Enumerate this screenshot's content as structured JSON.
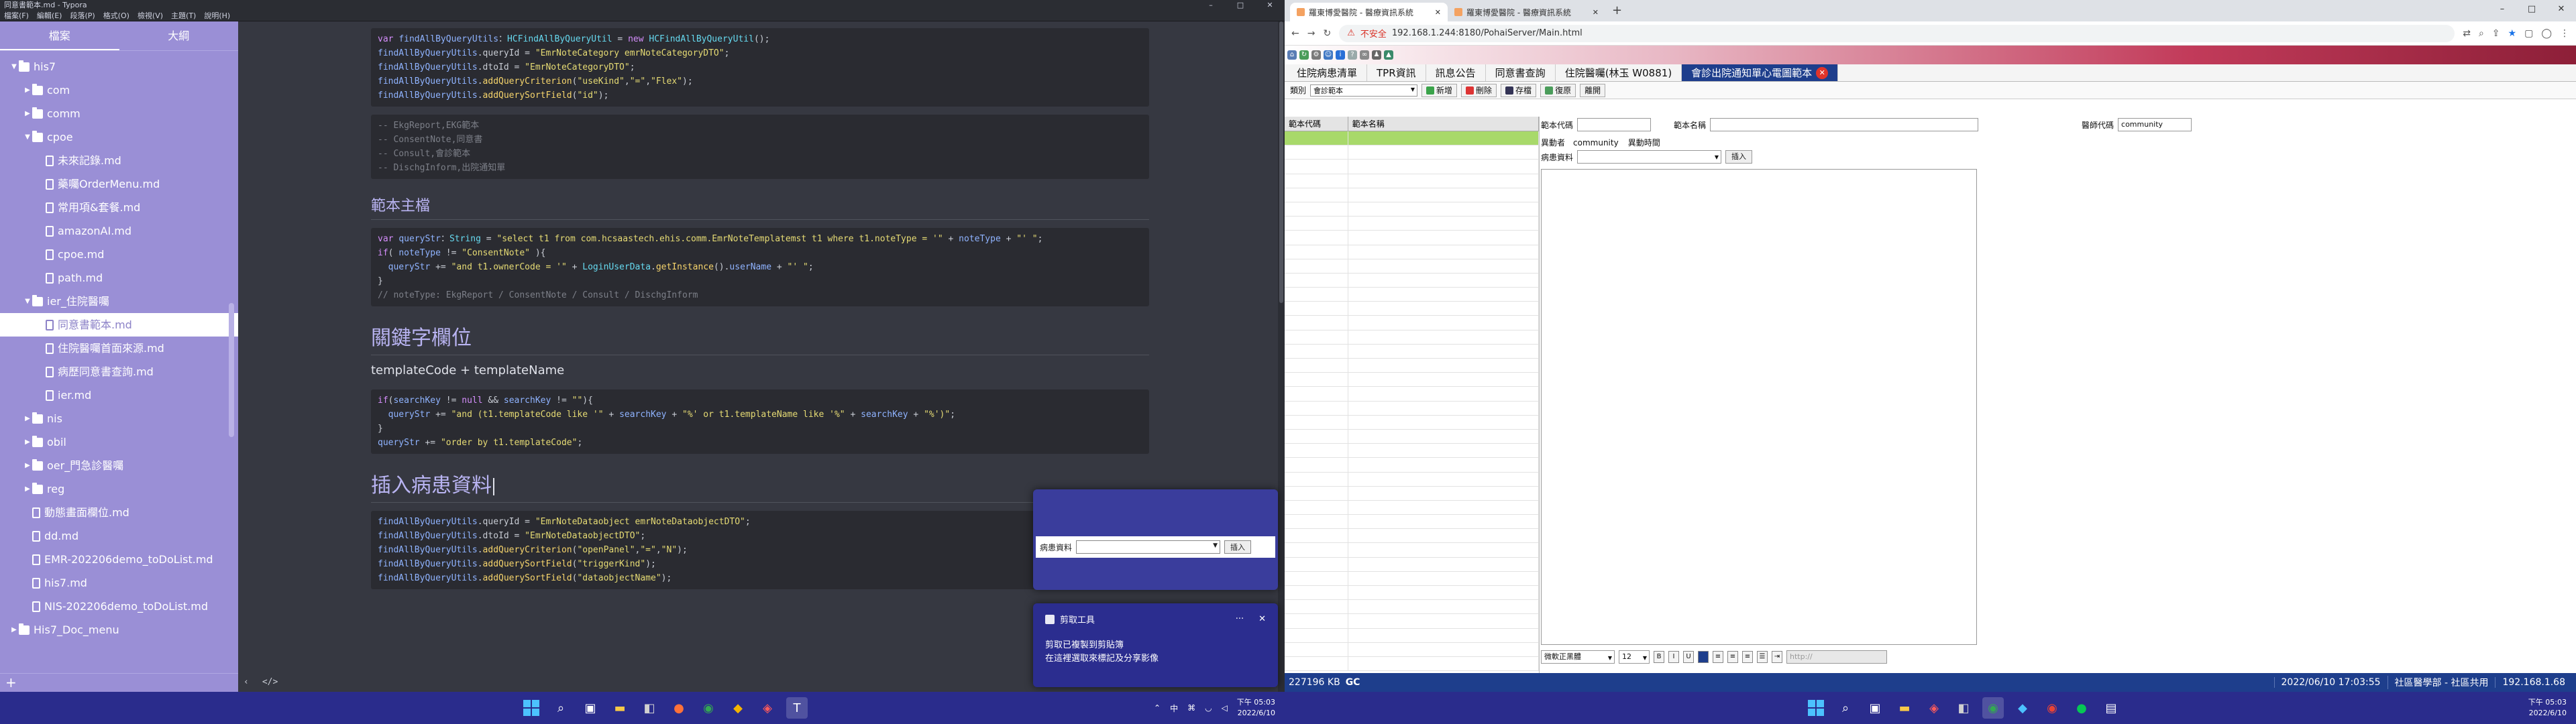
{
  "typora": {
    "title": "同意書範本.md - Typora",
    "menu": [
      "檔案(F)",
      "編輯(E)",
      "段落(P)",
      "格式(O)",
      "檢視(V)",
      "主題(T)",
      "說明(H)"
    ],
    "sidebar_tabs": [
      "檔案",
      "大綱"
    ],
    "tree": [
      {
        "label": "his7",
        "type": "folder",
        "depth": 0,
        "open": true
      },
      {
        "label": "com",
        "type": "folder",
        "depth": 1,
        "open": false
      },
      {
        "label": "comm",
        "type": "folder",
        "depth": 1,
        "open": false
      },
      {
        "label": "cpoe",
        "type": "folder",
        "depth": 1,
        "open": true
      },
      {
        "label": "未來記錄.md",
        "type": "file",
        "depth": 2
      },
      {
        "label": "藥囑OrderMenu.md",
        "type": "file",
        "depth": 2
      },
      {
        "label": "常用項&套餐.md",
        "type": "file",
        "depth": 2
      },
      {
        "label": "amazonAI.md",
        "type": "file",
        "depth": 2
      },
      {
        "label": "cpoe.md",
        "type": "file",
        "depth": 2
      },
      {
        "label": "path.md",
        "type": "file",
        "depth": 2
      },
      {
        "label": "ier_住院醫囑",
        "type": "folder",
        "depth": 1,
        "open": true
      },
      {
        "label": "同意書範本.md",
        "type": "file",
        "depth": 2,
        "selected": true
      },
      {
        "label": "住院醫囑首面來源.md",
        "type": "file",
        "depth": 2
      },
      {
        "label": "病歷同意書查詢.md",
        "type": "file",
        "depth": 2
      },
      {
        "label": "ier.md",
        "type": "file",
        "depth": 2
      },
      {
        "label": "nis",
        "type": "folder",
        "depth": 1,
        "open": false
      },
      {
        "label": "obil",
        "type": "folder",
        "depth": 1,
        "open": false
      },
      {
        "label": "oer_門急診醫囑",
        "type": "folder",
        "depth": 1,
        "open": false
      },
      {
        "label": "reg",
        "type": "folder",
        "depth": 1,
        "open": false
      },
      {
        "label": "動態畫面欄位.md",
        "type": "file",
        "depth": 1
      },
      {
        "label": "dd.md",
        "type": "file",
        "depth": 1
      },
      {
        "label": "EMR-202206demo_toDoList.md",
        "type": "file",
        "depth": 1
      },
      {
        "label": "his7.md",
        "type": "file",
        "depth": 1
      },
      {
        "label": "NIS-202206demo_toDoList.md",
        "type": "file",
        "depth": 1
      },
      {
        "label": "His7_Doc_menu",
        "type": "folder",
        "depth": 0,
        "open": false
      }
    ],
    "sidebar_add": "+",
    "code1": [
      [
        [
          "kw",
          "var "
        ],
        [
          "vr",
          "findAllByQueryUtils"
        ],
        [
          "",
          "："
        ],
        [
          "ty",
          "HCFindAllByQueryUtil"
        ],
        [
          "",
          " = "
        ],
        [
          "kw",
          "new "
        ],
        [
          "ty",
          "HCFindAllByQueryUtil"
        ],
        [
          "",
          "();"
        ]
      ],
      [
        [
          "vr",
          "findAllByQueryUtils"
        ],
        [
          "",
          ".queryId = "
        ],
        [
          "st",
          "\"EmrNoteCategory emrNoteCategoryDTO\""
        ],
        [
          "",
          ";"
        ]
      ],
      [
        [
          "vr",
          "findAllByQueryUtils"
        ],
        [
          "",
          ".dtoId = "
        ],
        [
          "st",
          "\"EmrNoteCategoryDTO\""
        ],
        [
          "",
          ";"
        ]
      ],
      [
        [
          "vr",
          "findAllByQueryUtils"
        ],
        [
          "",
          "."
        ],
        [
          "fn",
          "addQueryCriterion"
        ],
        [
          "",
          "("
        ],
        [
          "st",
          "\"useKind\""
        ],
        [
          "",
          ","
        ],
        [
          "st",
          "\"=\""
        ],
        [
          "",
          ","
        ],
        [
          "st",
          "\"Flex\""
        ],
        [
          "",
          ");"
        ]
      ],
      [
        [
          "vr",
          "findAllByQueryUtils"
        ],
        [
          "",
          "."
        ],
        [
          "fn",
          "addQuerySortField"
        ],
        [
          "",
          "("
        ],
        [
          "st",
          "\"id\""
        ],
        [
          "",
          ");"
        ]
      ]
    ],
    "code2": [
      [
        [
          "cm",
          "-- EkgReport,EKG範本"
        ]
      ],
      [
        [
          "cm",
          "-- ConsentNote,同意書"
        ]
      ],
      [
        [
          "cm",
          "-- Consult,會診範本"
        ]
      ],
      [
        [
          "cm",
          "-- DischgInform,出院通知單"
        ]
      ]
    ],
    "h_template": "範本主檔",
    "code3": [
      [
        [
          "kw",
          "var "
        ],
        [
          "vr",
          "queryStr"
        ],
        [
          "",
          "："
        ],
        [
          "ty",
          "String"
        ],
        [
          "",
          " = "
        ],
        [
          "st",
          "\"select t1 from com.hcsaastech.ehis.comm.EmrNoteTemplatemst t1 where t1.noteType = '\""
        ],
        [
          "",
          " + "
        ],
        [
          "vr",
          "noteType"
        ],
        [
          "",
          " + "
        ],
        [
          "st",
          "\"' \""
        ],
        [
          "",
          ";"
        ]
      ],
      [
        [
          "kw",
          "if"
        ],
        [
          "",
          "( "
        ],
        [
          "vr",
          "noteType"
        ],
        [
          "",
          " != "
        ],
        [
          "st",
          "\"ConsentNote\""
        ],
        [
          "",
          " ){"
        ]
      ],
      [
        [
          "",
          "  "
        ],
        [
          "vr",
          "queryStr"
        ],
        [
          "",
          " += "
        ],
        [
          "st",
          "\"and t1.ownerCode = '\""
        ],
        [
          "",
          " + "
        ],
        [
          "ty",
          "LoginUserData"
        ],
        [
          "",
          "."
        ],
        [
          "fn",
          "getInstance"
        ],
        [
          "",
          "()."
        ],
        [
          "vr",
          "userName"
        ],
        [
          "",
          " + "
        ],
        [
          "st",
          "\"' \""
        ],
        [
          "",
          ";"
        ]
      ],
      [
        [
          "",
          "}"
        ]
      ],
      [
        [
          "cm",
          "// noteType: EkgReport / ConsentNote / Consult / DischgInform"
        ]
      ]
    ],
    "h_keyword": "關鍵字欄位",
    "para_keyword": "templateCode + templateName",
    "code4": [
      [
        [
          "kw",
          "if"
        ],
        [
          "",
          "("
        ],
        [
          "vr",
          "searchKey"
        ],
        [
          "",
          " != "
        ],
        [
          "kw",
          "null"
        ],
        [
          "",
          " && "
        ],
        [
          "vr",
          "searchKey"
        ],
        [
          "",
          " != "
        ],
        [
          "st",
          "\"\""
        ],
        [
          "",
          "){"
        ]
      ],
      [
        [
          "",
          "  "
        ],
        [
          "vr",
          "queryStr"
        ],
        [
          "",
          " += "
        ],
        [
          "st",
          "\"and (t1.templateCode like '\""
        ],
        [
          "",
          " + "
        ],
        [
          "vr",
          "searchKey"
        ],
        [
          "",
          " + "
        ],
        [
          "st",
          "\"%' or t1.templateName like '%\""
        ],
        [
          "",
          " + "
        ],
        [
          "vr",
          "searchKey"
        ],
        [
          "",
          " + "
        ],
        [
          "st",
          "\"%')\""
        ],
        [
          "",
          ";"
        ]
      ],
      [
        [
          "",
          "}"
        ]
      ],
      [
        [
          "vr",
          "queryStr"
        ],
        [
          "",
          " += "
        ],
        [
          "st",
          "\"order by t1.templateCode\""
        ],
        [
          "",
          ";"
        ]
      ]
    ],
    "h_insert": "插入病患資料",
    "code5": [
      [
        [
          "vr",
          "findAllByQueryUtils"
        ],
        [
          "",
          ".queryId = "
        ],
        [
          "st",
          "\"EmrNoteDataobject emrNoteDataobjectDTO\""
        ],
        [
          "",
          ";"
        ]
      ],
      [
        [
          "vr",
          "findAllByQueryUtils"
        ],
        [
          "",
          ".dtoId = "
        ],
        [
          "st",
          "\"EmrNoteDataobjectDTO\""
        ],
        [
          "",
          ";"
        ]
      ],
      [
        [
          "vr",
          "findAllByQueryUtils"
        ],
        [
          "",
          "."
        ],
        [
          "fn",
          "addQueryCriterion"
        ],
        [
          "",
          "("
        ],
        [
          "st",
          "\"openPanel\""
        ],
        [
          "",
          ","
        ],
        [
          "st",
          "\"=\""
        ],
        [
          "",
          ","
        ],
        [
          "st",
          "\"N\""
        ],
        [
          "",
          ");"
        ]
      ],
      [
        [
          "vr",
          "findAllByQueryUtils"
        ],
        [
          "",
          "."
        ],
        [
          "fn",
          "addQuerySortField"
        ],
        [
          "",
          "("
        ],
        [
          "st",
          "\"triggerKind\""
        ],
        [
          "",
          ");"
        ]
      ],
      [
        [
          "vr",
          "findAllByQueryUtils"
        ],
        [
          "",
          "."
        ],
        [
          "fn",
          "addQuerySortField"
        ],
        [
          "",
          "("
        ],
        [
          "st",
          "\"dataobjectName\""
        ],
        [
          "",
          ");"
        ]
      ]
    ],
    "status_nav": "‹",
    "status_source": "</>"
  },
  "popup": {
    "label": "病患資料",
    "insert": "插入"
  },
  "notification": {
    "app": "剪取工具",
    "menu": "···",
    "close": "✕",
    "line1": "剪取已複製到剪貼簿",
    "line2": "在這裡選取來標記及分享影像"
  },
  "taskbar_left": {
    "tray_ime": "中",
    "time": "下午 05:03",
    "date": "2022/6/10"
  },
  "taskbar_right": {
    "time": "下午 05:03",
    "date": "2022/6/10"
  },
  "browser": {
    "tabs": [
      "羅東博愛醫院 - 醫療資訊系統",
      "羅東博愛醫院 - 醫療資訊系統"
    ],
    "new_tab": "+",
    "insecure": "不安全",
    "url": "192.168.1.244:8180/PohaiServer/Main.html"
  },
  "app": {
    "nav": [
      "住院病患清單",
      "TPR資訊",
      "訊息公告",
      "同意書查詢",
      "住院醫囑(林玉 W0881)",
      "會診出院通知單心電圖範本"
    ],
    "toolbar": {
      "category_label": "類別",
      "category_value": "會診範本",
      "add": "新增",
      "delete": "刪除",
      "save": "存檔",
      "restore": "復原",
      "exit": "離開"
    },
    "grid_headers": [
      "範本代碼",
      "範本名稱"
    ],
    "form": {
      "code_label": "範本代碼",
      "name_label": "範本名稱",
      "doctor_label": "醫師代碼",
      "doctor_value": "community",
      "updater_label": "異動者",
      "updater_value": "community",
      "update_time_label": "異動時間",
      "patient_label": "病患資料",
      "insert": "插入"
    },
    "editor_toolbar": {
      "font": "微軟正黑體",
      "size": "12",
      "bold": "B",
      "italic": "I",
      "underline": "U",
      "link_placeholder": "http://"
    },
    "status": {
      "memory": "227196 KB",
      "gc": "GC",
      "datetime": "2022/06/10 17:03:55",
      "dept": "社區醫學部 - 社區共用",
      "ip": "192.168.1.68"
    }
  }
}
